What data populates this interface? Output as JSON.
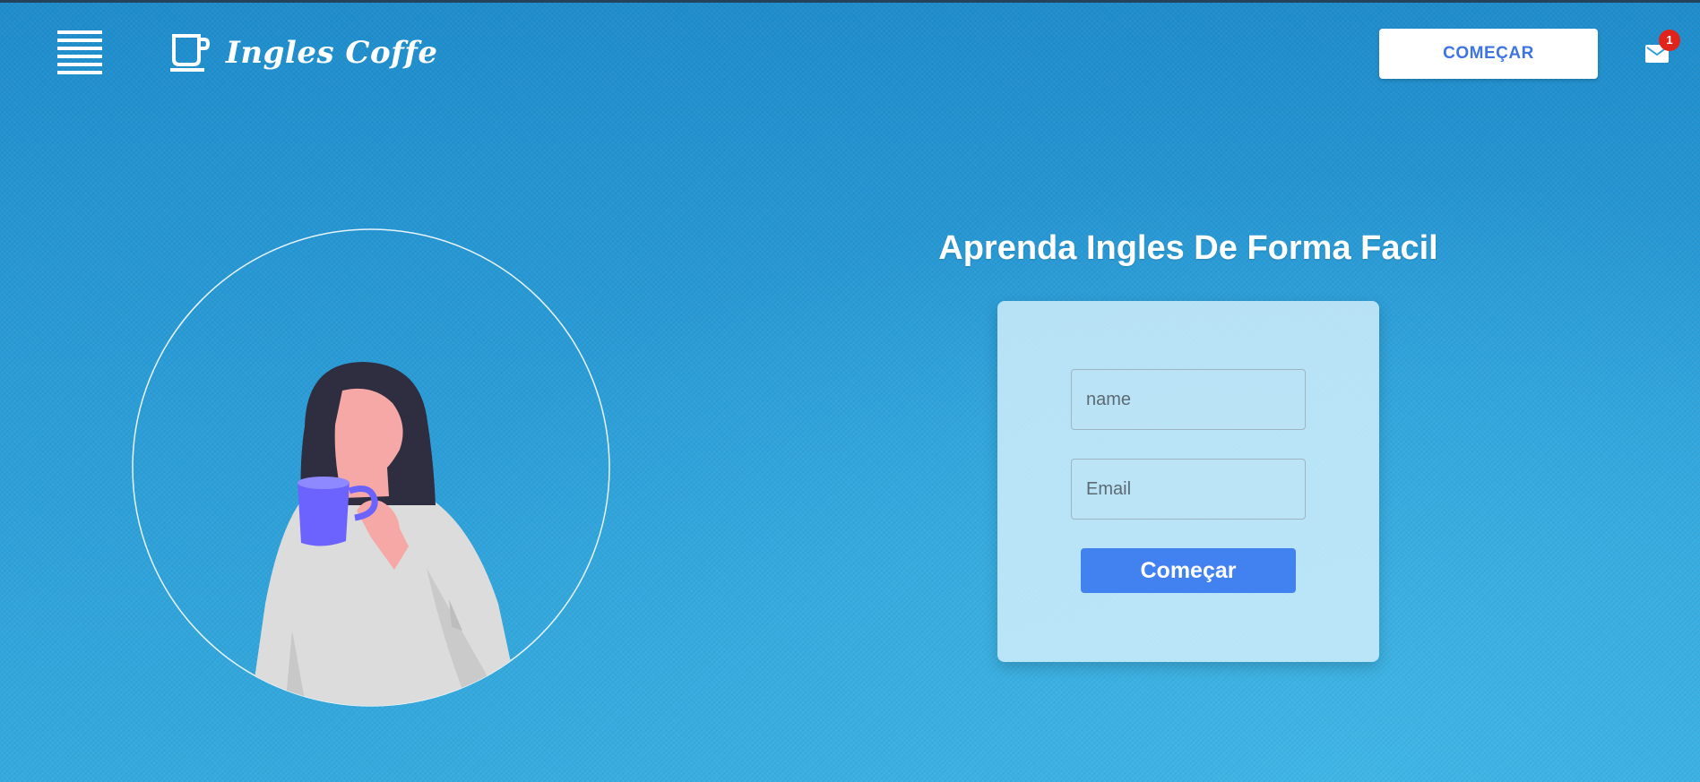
{
  "header": {
    "menu_icon": "hamburger-menu-icon",
    "logo_icon": "coffee-cup-icon",
    "brand_name": "Ingles Coffe",
    "start_button_label": "COMEÇAR",
    "mail_icon": "envelope-icon",
    "notification_count": "1"
  },
  "hero": {
    "illustration": "woman-drinking-coffee-illustration",
    "headline": "Aprenda Ingles De Forma Facil"
  },
  "form": {
    "name_placeholder": "name",
    "email_placeholder": "Email",
    "submit_label": "Começar"
  },
  "colors": {
    "background": "#2e9fd8",
    "accent": "#4281f0",
    "header_button_text": "#3f74e3",
    "badge": "#e0241b",
    "mug": "#6c63ff"
  }
}
